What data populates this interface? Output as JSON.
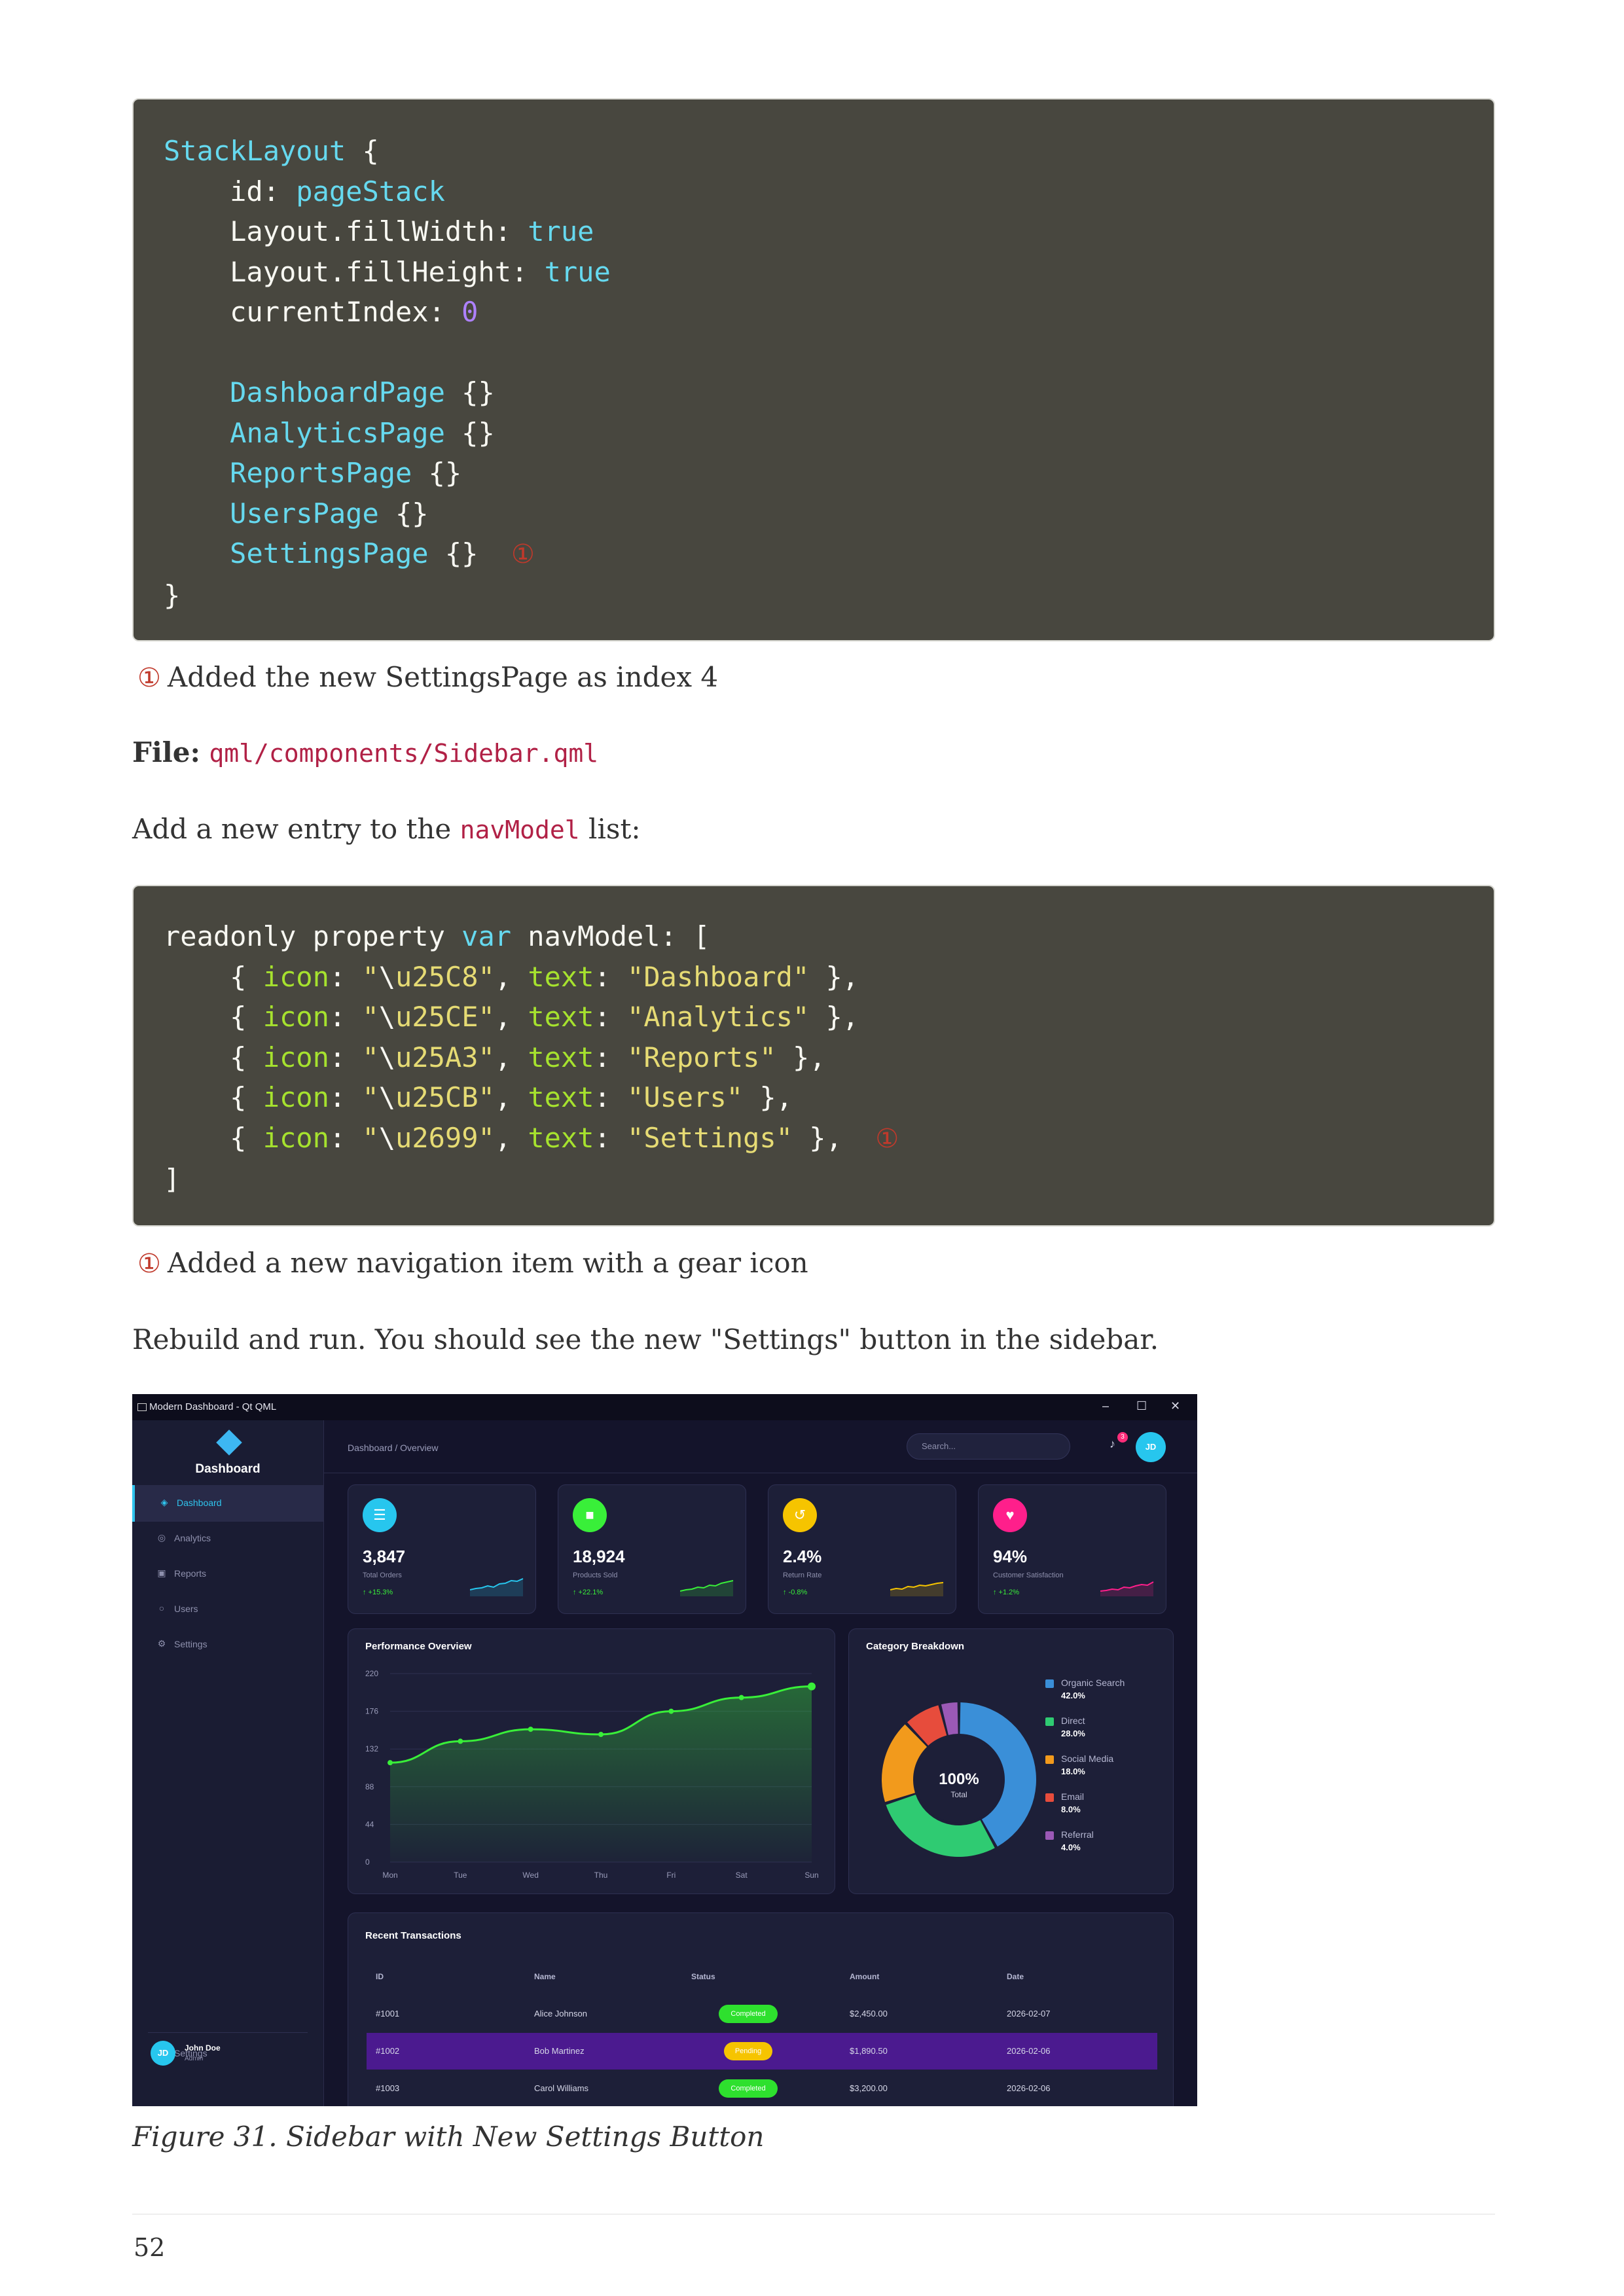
{
  "code1": {
    "lines": [
      [
        {
          "c": "t",
          "v": "StackLayout"
        },
        {
          "c": "",
          "v": " {"
        }
      ],
      [
        {
          "c": "",
          "v": "    id: "
        },
        {
          "c": "t",
          "v": "pageStack"
        }
      ],
      [
        {
          "c": "",
          "v": "    Layout.fillWidth: "
        },
        {
          "c": "t",
          "v": "true"
        }
      ],
      [
        {
          "c": "",
          "v": "    Layout.fillHeight: "
        },
        {
          "c": "t",
          "v": "true"
        }
      ],
      [
        {
          "c": "",
          "v": "    currentIndex: "
        },
        {
          "c": "n",
          "v": "0"
        }
      ],
      [
        {
          "c": "",
          "v": ""
        }
      ],
      [
        {
          "c": "",
          "v": "    "
        },
        {
          "c": "t",
          "v": "DashboardPage"
        },
        {
          "c": "",
          "v": " {}"
        }
      ],
      [
        {
          "c": "",
          "v": "    "
        },
        {
          "c": "t",
          "v": "AnalyticsPage"
        },
        {
          "c": "",
          "v": " {}"
        }
      ],
      [
        {
          "c": "",
          "v": "    "
        },
        {
          "c": "t",
          "v": "ReportsPage"
        },
        {
          "c": "",
          "v": " {}"
        }
      ],
      [
        {
          "c": "",
          "v": "    "
        },
        {
          "c": "t",
          "v": "UsersPage"
        },
        {
          "c": "",
          "v": " {}"
        }
      ],
      [
        {
          "c": "",
          "v": "    "
        },
        {
          "c": "t",
          "v": "SettingsPage"
        },
        {
          "c": "",
          "v": " {}  "
        },
        {
          "c": "callout",
          "v": "①"
        }
      ],
      [
        {
          "c": "",
          "v": "}"
        }
      ]
    ]
  },
  "note1": {
    "marker": "①",
    "text": "Added the new SettingsPage as index 4"
  },
  "file_label": "File:",
  "file_path": "qml/components/Sidebar.qml",
  "para_add": {
    "before": "Add a new entry to the ",
    "code": "navModel",
    "after": " list:"
  },
  "code2": {
    "lines": [
      [
        {
          "c": "",
          "v": "readonly property "
        },
        {
          "c": "t",
          "v": "var"
        },
        {
          "c": "",
          "v": " navModel: ["
        }
      ],
      [
        {
          "c": "",
          "v": "    { "
        },
        {
          "c": "k",
          "v": "icon"
        },
        {
          "c": "",
          "v": ": "
        },
        {
          "c": "s",
          "v": "\""
        },
        {
          "c": "",
          "v": "\\"
        },
        {
          "c": "s",
          "v": "u25C8\""
        },
        {
          "c": "",
          "v": ", "
        },
        {
          "c": "k",
          "v": "text"
        },
        {
          "c": "",
          "v": ": "
        },
        {
          "c": "s",
          "v": "\"Dashboard\""
        },
        {
          "c": "",
          "v": " },"
        }
      ],
      [
        {
          "c": "",
          "v": "    { "
        },
        {
          "c": "k",
          "v": "icon"
        },
        {
          "c": "",
          "v": ": "
        },
        {
          "c": "s",
          "v": "\""
        },
        {
          "c": "",
          "v": "\\"
        },
        {
          "c": "s",
          "v": "u25CE\""
        },
        {
          "c": "",
          "v": ", "
        },
        {
          "c": "k",
          "v": "text"
        },
        {
          "c": "",
          "v": ": "
        },
        {
          "c": "s",
          "v": "\"Analytics\""
        },
        {
          "c": "",
          "v": " },"
        }
      ],
      [
        {
          "c": "",
          "v": "    { "
        },
        {
          "c": "k",
          "v": "icon"
        },
        {
          "c": "",
          "v": ": "
        },
        {
          "c": "s",
          "v": "\""
        },
        {
          "c": "",
          "v": "\\"
        },
        {
          "c": "s",
          "v": "u25A3\""
        },
        {
          "c": "",
          "v": ", "
        },
        {
          "c": "k",
          "v": "text"
        },
        {
          "c": "",
          "v": ": "
        },
        {
          "c": "s",
          "v": "\"Reports\""
        },
        {
          "c": "",
          "v": " },"
        }
      ],
      [
        {
          "c": "",
          "v": "    { "
        },
        {
          "c": "k",
          "v": "icon"
        },
        {
          "c": "",
          "v": ": "
        },
        {
          "c": "s",
          "v": "\""
        },
        {
          "c": "",
          "v": "\\"
        },
        {
          "c": "s",
          "v": "u25CB\""
        },
        {
          "c": "",
          "v": ", "
        },
        {
          "c": "k",
          "v": "text"
        },
        {
          "c": "",
          "v": ": "
        },
        {
          "c": "s",
          "v": "\"Users\""
        },
        {
          "c": "",
          "v": " },"
        }
      ],
      [
        {
          "c": "",
          "v": "    { "
        },
        {
          "c": "k",
          "v": "icon"
        },
        {
          "c": "",
          "v": ": "
        },
        {
          "c": "s",
          "v": "\""
        },
        {
          "c": "",
          "v": "\\"
        },
        {
          "c": "s",
          "v": "u2699\""
        },
        {
          "c": "",
          "v": ", "
        },
        {
          "c": "k",
          "v": "text"
        },
        {
          "c": "",
          "v": ": "
        },
        {
          "c": "s",
          "v": "\"Settings\""
        },
        {
          "c": "",
          "v": " },  "
        },
        {
          "c": "callout",
          "v": "①"
        }
      ],
      [
        {
          "c": "",
          "v": "]"
        }
      ]
    ]
  },
  "note2": {
    "marker": "①",
    "text": "Added a new navigation item with a gear icon"
  },
  "para_rebuild": "Rebuild and run. You should see the new \"Settings\" button in the sidebar.",
  "screenshot": {
    "window_title": "Modern Dashboard - Qt QML",
    "window_controls": [
      "–",
      "☐",
      "✕"
    ],
    "sidebar": {
      "title": "Dashboard",
      "items": [
        {
          "icon": "◈",
          "label": "Dashboard",
          "active": true
        },
        {
          "icon": "◎",
          "label": "Analytics"
        },
        {
          "icon": "▣",
          "label": "Reports"
        },
        {
          "icon": "○",
          "label": "Users"
        },
        {
          "icon": "⚙",
          "label": "Settings"
        }
      ],
      "bottom_settings": {
        "icon": "⚙",
        "label": "Settings"
      },
      "user": {
        "initials": "JD",
        "name": "John Doe",
        "role": "Admin"
      }
    },
    "header": {
      "breadcrumb": "Dashboard  /  Overview",
      "search_placeholder": "Search...",
      "notification_count": "3",
      "avatar_initials": "JD"
    },
    "stats": [
      {
        "icon": "☰",
        "color": "#27c6ee",
        "value": "3,847",
        "label": "Total Orders",
        "change": "↑ +15.3%",
        "spark": "#27c6ee"
      },
      {
        "icon": "■",
        "color": "#39ef39",
        "value": "18,924",
        "label": "Products Sold",
        "change": "↑ +22.1%",
        "spark": "#39ef39"
      },
      {
        "icon": "↺",
        "color": "#f6c400",
        "value": "2.4%",
        "label": "Return Rate",
        "change": "↑ -0.8%",
        "spark": "#f6c400"
      },
      {
        "icon": "♥",
        "color": "#ff1f8b",
        "value": "94%",
        "label": "Customer Satisfaction",
        "change": "↑ +1.2%",
        "spark": "#ff1f8b"
      }
    ],
    "performance_title": "Performance Overview",
    "category_title": "Category Breakdown",
    "donut_center": {
      "value": "100%",
      "label": "Total"
    },
    "transactions": {
      "title": "Recent Transactions",
      "columns": [
        "ID",
        "Name",
        "Status",
        "Amount",
        "Date"
      ],
      "rows": [
        {
          "id": "#1001",
          "name": "Alice Johnson",
          "status": "Completed",
          "amount": "$2,450.00",
          "date": "2026-02-07"
        },
        {
          "id": "#1002",
          "name": "Bob Martinez",
          "status": "Pending",
          "amount": "$1,890.50",
          "date": "2026-02-06"
        },
        {
          "id": "#1003",
          "name": "Carol Williams",
          "status": "Completed",
          "amount": "$3,200.00",
          "date": "2026-02-06"
        }
      ]
    }
  },
  "chart_data": [
    {
      "type": "area",
      "title": "Performance Overview",
      "categories": [
        "Mon",
        "Tue",
        "Wed",
        "Thu",
        "Fri",
        "Sat",
        "Sun"
      ],
      "series": [
        {
          "values": [
            116,
            141,
            155,
            149,
            176,
            192,
            205
          ],
          "color": "#39ef39"
        }
      ],
      "yticks": [
        0,
        44,
        88,
        132,
        176,
        220
      ],
      "ylim": [
        0,
        220
      ],
      "grid": true
    },
    {
      "type": "pie",
      "title": "Category Breakdown",
      "donut": true,
      "legend_position": "right",
      "slices": [
        {
          "label": "Organic Search",
          "value": 42.0,
          "display": "42.0%",
          "color": "#3a8fd8"
        },
        {
          "label": "Direct",
          "value": 28.0,
          "display": "28.0%",
          "color": "#2fcb72"
        },
        {
          "label": "Social Media",
          "value": 18.0,
          "display": "18.0%",
          "color": "#f29a1c"
        },
        {
          "label": "Email",
          "value": 8.0,
          "display": "8.0%",
          "color": "#e74c3c"
        },
        {
          "label": "Referral",
          "value": 4.0,
          "display": "4.0%",
          "color": "#9b59b6"
        }
      ]
    }
  ],
  "figure_caption": "Figure 31. Sidebar with New Settings Button",
  "page_number": "52"
}
